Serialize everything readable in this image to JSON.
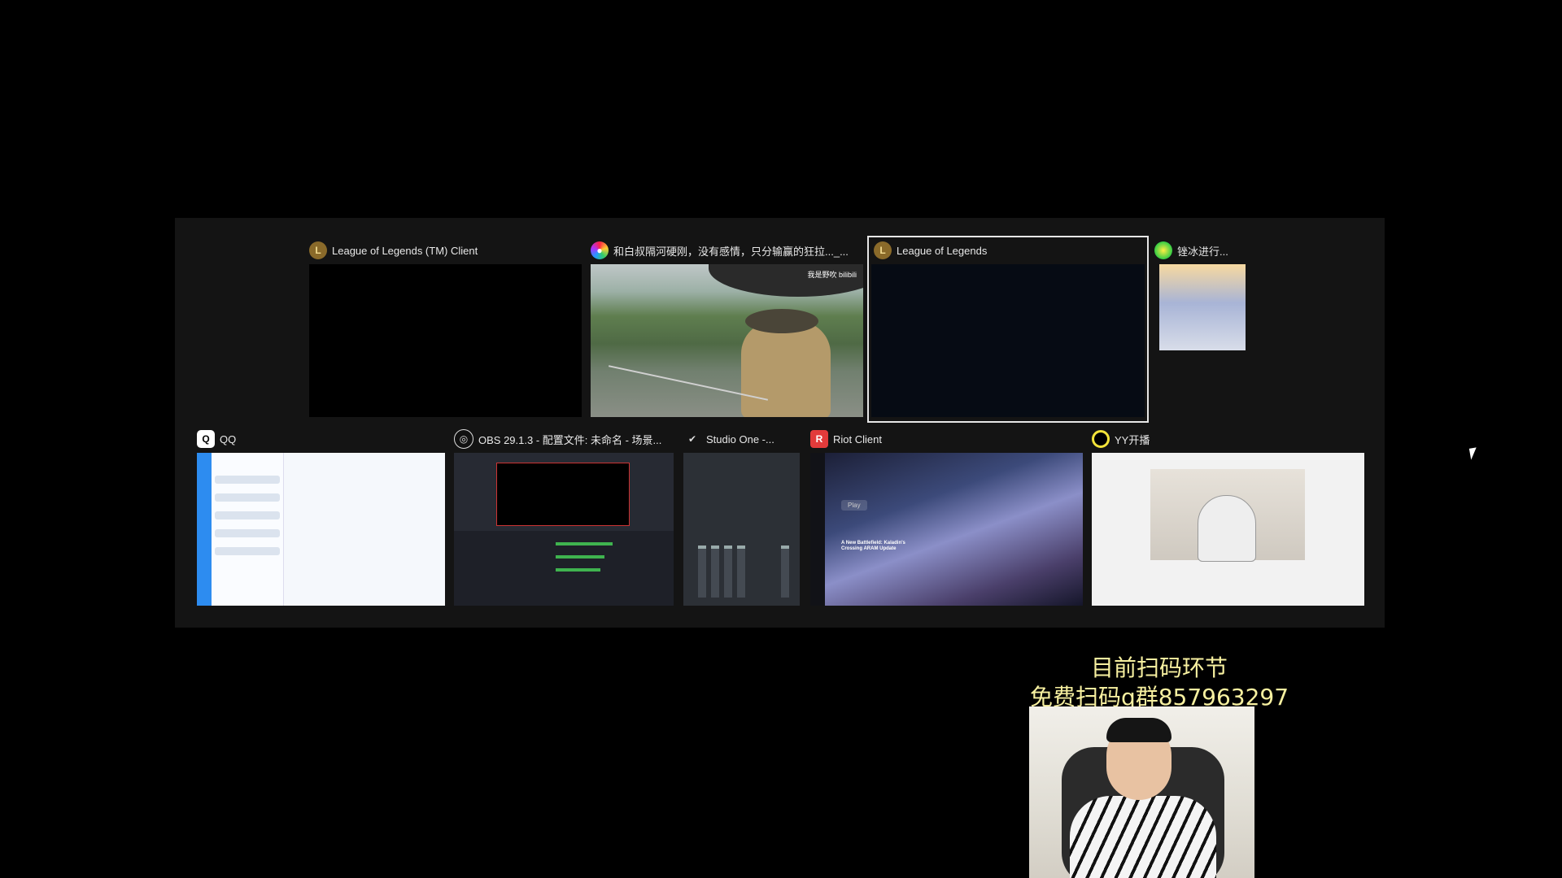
{
  "windows": {
    "lol_client": {
      "title": "League of Legends (TM) Client",
      "icon": "lol-icon",
      "icon_color": "#c8a85a"
    },
    "video": {
      "title": "和白叔隔河硬刚，没有感情，只分输赢的狂拉..._...",
      "icon": "video-player-icon",
      "overlay_text": "我是野吹 bilibili"
    },
    "lol": {
      "title": "League of Legends",
      "icon": "lol-icon",
      "selected": true
    },
    "ice": {
      "title": "锉冰进行...",
      "icon": "ball-icon"
    },
    "qq": {
      "title": "QQ",
      "icon": "qq-penguin-icon"
    },
    "obs": {
      "title": "OBS 29.1.3 - 配置文件: 未命名 - 场景...",
      "icon": "obs-icon"
    },
    "studio": {
      "title": "Studio One -...",
      "icon": "studio-one-icon"
    },
    "riot": {
      "title": "Riot Client",
      "icon": "riot-fist-icon",
      "icon_color": "#e23b3b"
    },
    "yy": {
      "title": "YY开播",
      "icon": "yy-ring-icon",
      "icon_color": "#f3e33a"
    }
  },
  "riot_preview": {
    "play": "Play",
    "headline": "A New Battlefield: Kaladin's Crossing ARAM Update"
  },
  "overlay": {
    "line1": "目前扫码环节",
    "line2": "免费扫码q群857963297",
    "color": "#f7f0a0"
  }
}
